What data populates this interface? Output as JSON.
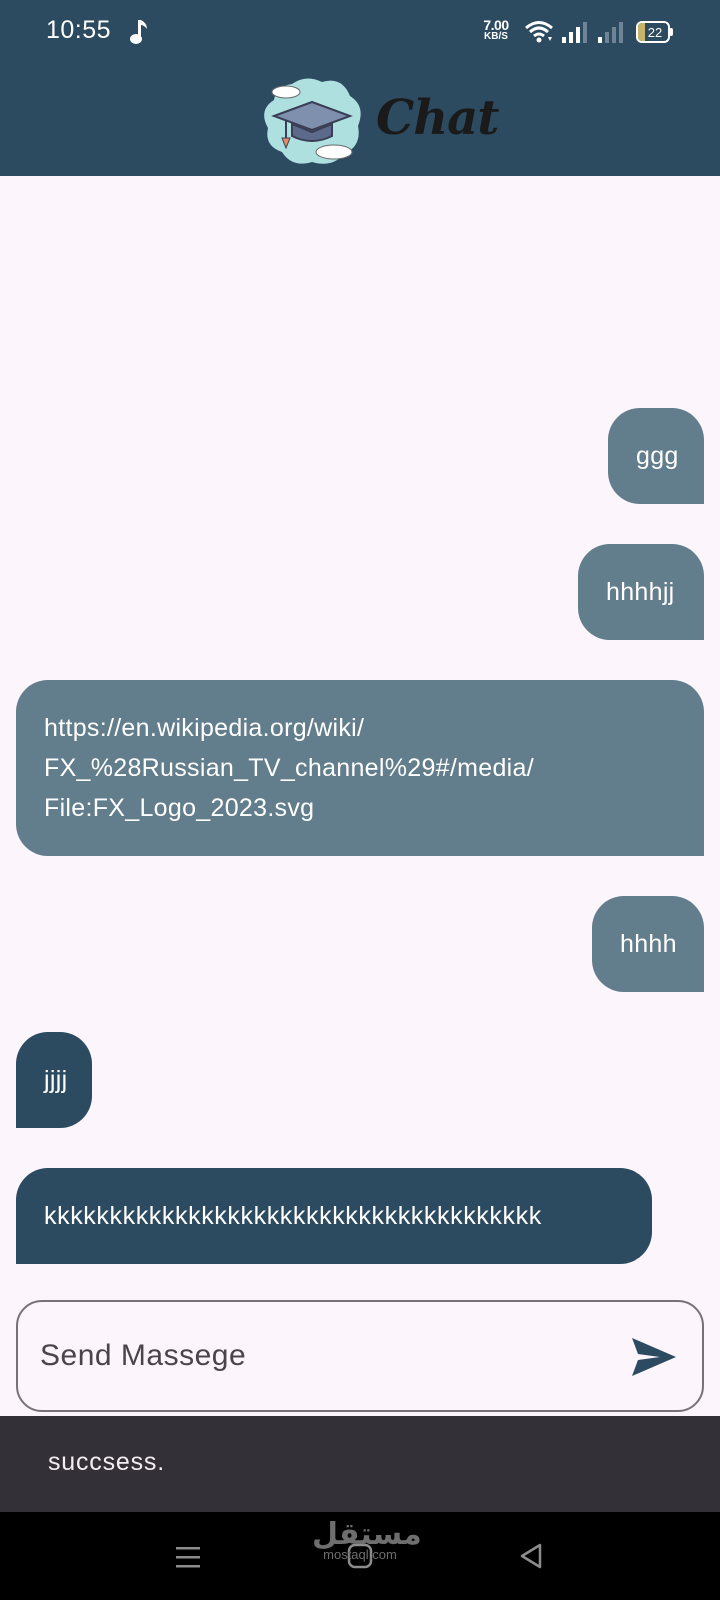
{
  "status_bar": {
    "time": "10:55",
    "net_speed_value": "7.00",
    "net_speed_unit": "KB/S",
    "battery_percent": "22",
    "icons": [
      "music-note-icon",
      "wifi-icon",
      "signal-icon",
      "signal-icon",
      "battery-icon"
    ]
  },
  "app_bar": {
    "title": "Chat",
    "logo_icon": "graduation-cap-logo"
  },
  "messages": [
    {
      "text": "ggg",
      "direction": "sent"
    },
    {
      "text": "hhhhjj",
      "direction": "sent"
    },
    {
      "lines": [
        "https://en.wikipedia.org/wiki/",
        "FX_%28Russian_TV_channel%29#/media/",
        "File:FX_Logo_2023.svg"
      ],
      "direction": "sent"
    },
    {
      "text": "hhhh",
      "direction": "sent"
    },
    {
      "text": "jjjj",
      "direction": "received"
    },
    {
      "text": "kkkkkkkkkkkkkkkkkkkkkkkkkkkkkkkkkkkkkk",
      "direction": "received"
    }
  ],
  "composer": {
    "placeholder": "Send Massege",
    "value": "",
    "send_icon": "send-icon"
  },
  "snackbar": {
    "text": "succsess."
  },
  "watermark": {
    "arabic": "مستقل",
    "latin": "mostaql.com"
  },
  "colors": {
    "primary": "#2c4a60",
    "sent_bubble": "#627d8b",
    "received_bubble": "#2c4a60",
    "background": "#fcf5fc",
    "snackbar": "#333037"
  }
}
